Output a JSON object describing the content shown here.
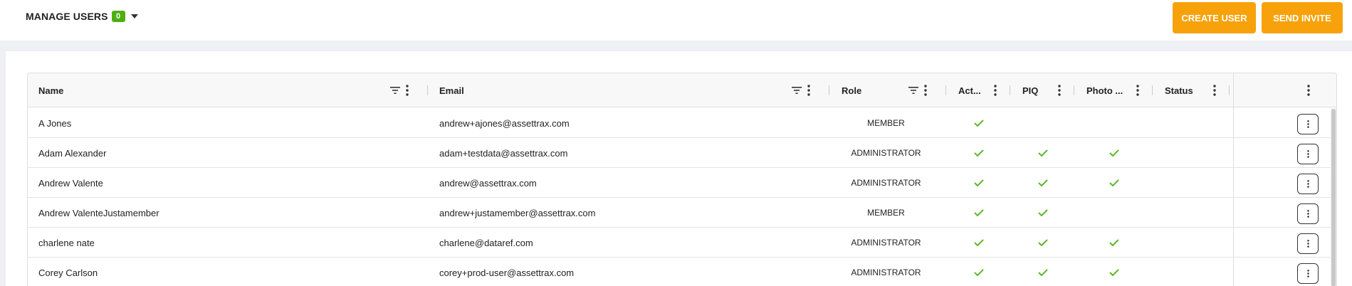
{
  "header": {
    "title": "MANAGE USERS",
    "count": "0",
    "create_label": "CREATE USER",
    "invite_label": "SEND INVITE"
  },
  "columns": {
    "name": "Name",
    "email": "Email",
    "role": "Role",
    "active": "Act...",
    "piq": "PIQ",
    "photo": "Photo ...",
    "status": "Status"
  },
  "rows": [
    {
      "name": "A Jones",
      "email": "andrew+ajones@assettrax.com",
      "role": "MEMBER",
      "active": true,
      "piq": false,
      "photo": false
    },
    {
      "name": "Adam Alexander",
      "email": "adam+testdata@assettrax.com",
      "role": "ADMINISTRATOR",
      "active": true,
      "piq": true,
      "photo": true
    },
    {
      "name": "Andrew Valente",
      "email": "andrew@assettrax.com",
      "role": "ADMINISTRATOR",
      "active": true,
      "piq": true,
      "photo": true
    },
    {
      "name": "Andrew ValenteJustamember",
      "email": "andrew+justamember@assettrax.com",
      "role": "MEMBER",
      "active": true,
      "piq": true,
      "photo": false
    },
    {
      "name": "charlene nate",
      "email": "charlene@dataref.com",
      "role": "ADMINISTRATOR",
      "active": true,
      "piq": true,
      "photo": true
    },
    {
      "name": "Corey Carlson",
      "email": "corey+prod-user@assettrax.com",
      "role": "ADMINISTRATOR",
      "active": true,
      "piq": true,
      "photo": true
    }
  ],
  "colors": {
    "accent": "#f7a20b",
    "badge": "#4caf12",
    "check": "#5cb82a"
  },
  "icons": {
    "filter": "filter-icon",
    "menu": "vertical-dots-icon",
    "check": "check-icon",
    "dropdown": "caret-down-icon"
  }
}
